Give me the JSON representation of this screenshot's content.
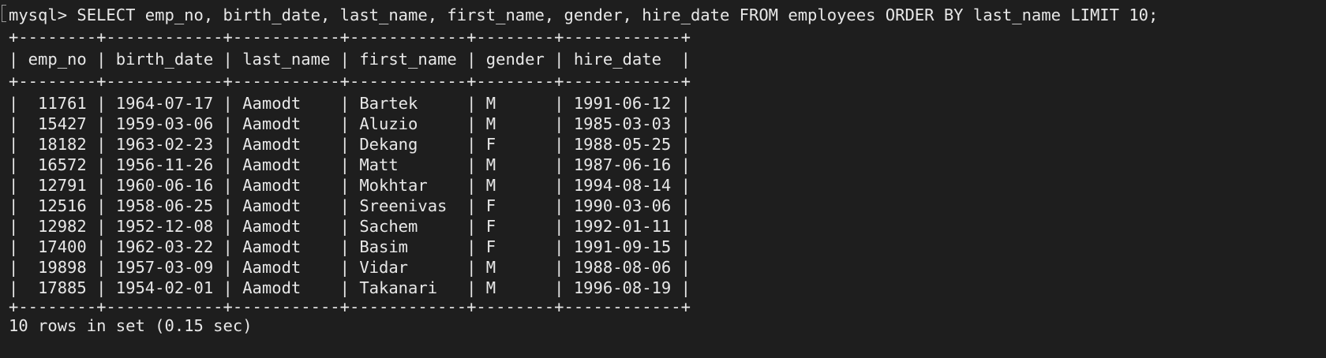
{
  "terminal": {
    "command_line": "mysql> SELECT emp_no, birth_date, last_name, first_name, gender, hire_date FROM employees ORDER BY last_name LIMIT 10;",
    "table": {
      "border_line": "+--------+------------+-----------+------------+--------+------------+",
      "header_line": "| emp_no | birth_date | last_name | first_name | gender | hire_date  |",
      "columns": [
        "emp_no",
        "birth_date",
        "last_name",
        "first_name",
        "gender",
        "hire_date"
      ],
      "rows": [
        [
          "11761",
          "1964-07-17",
          "Aamodt",
          "Bartek",
          "M",
          "1991-06-12"
        ],
        [
          "15427",
          "1959-03-06",
          "Aamodt",
          "Aluzio",
          "M",
          "1985-03-03"
        ],
        [
          "18182",
          "1963-02-23",
          "Aamodt",
          "Dekang",
          "F",
          "1988-05-25"
        ],
        [
          "16572",
          "1956-11-26",
          "Aamodt",
          "Matt",
          "M",
          "1987-06-16"
        ],
        [
          "12791",
          "1960-06-16",
          "Aamodt",
          "Mokhtar",
          "M",
          "1994-08-14"
        ],
        [
          "12516",
          "1958-06-25",
          "Aamodt",
          "Sreenivas",
          "F",
          "1990-03-06"
        ],
        [
          "12982",
          "1952-12-08",
          "Aamodt",
          "Sachem",
          "F",
          "1992-01-11"
        ],
        [
          "17400",
          "1962-03-22",
          "Aamodt",
          "Basim",
          "F",
          "1991-09-15"
        ],
        [
          "19898",
          "1957-03-09",
          "Aamodt",
          "Vidar",
          "M",
          "1988-08-06"
        ],
        [
          "17885",
          "1954-02-01",
          "Aamodt",
          "Takanari",
          "M",
          "1996-08-19"
        ]
      ]
    },
    "result_line": "10 rows in set (0.15 sec)"
  }
}
